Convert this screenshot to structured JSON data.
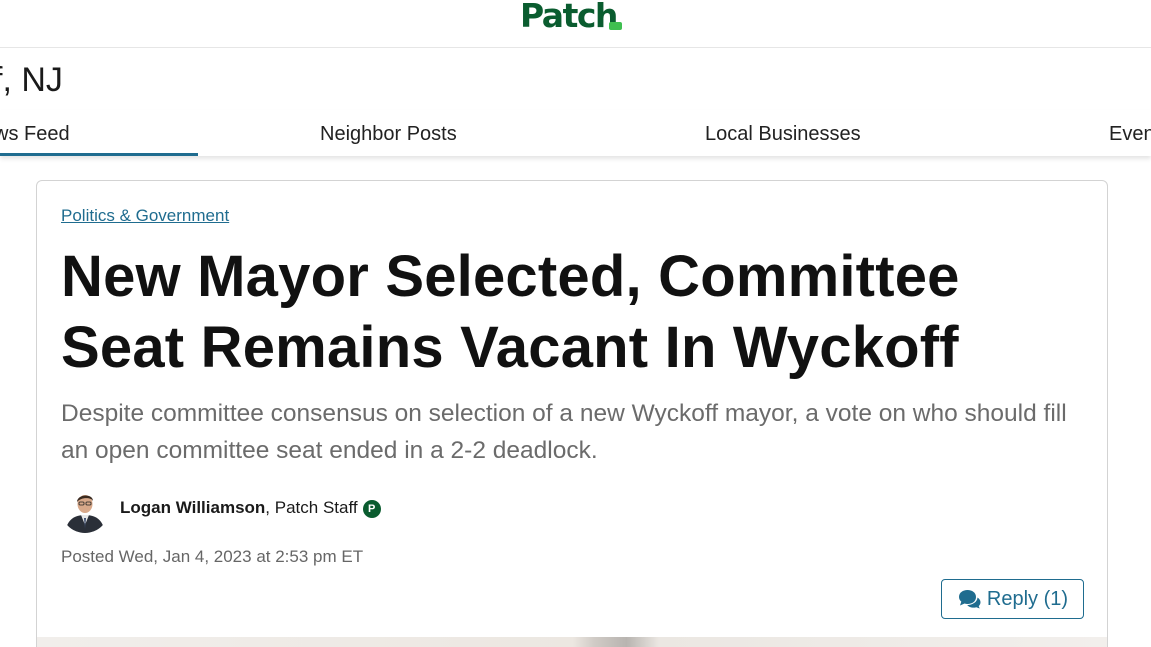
{
  "header": {
    "logo_text": "Patch",
    "town_title": "f, NJ"
  },
  "nav": {
    "items": [
      {
        "label": "ws Feed",
        "active": true
      },
      {
        "label": "Neighbor Posts",
        "active": false
      },
      {
        "label": "Local Businesses",
        "active": false
      },
      {
        "label": "Even",
        "active": false
      }
    ]
  },
  "article": {
    "category": "Politics & Government",
    "headline": "New Mayor Selected, Committee Seat Remains Vacant In Wyckoff",
    "dek": "Despite committee consensus on selection of a new Wyckoff mayor, a vote on who should fill an open committee seat ended in a 2-2 deadlock.",
    "author": {
      "name": "Logan Williamson",
      "separator": ",",
      "role": "Patch Staff",
      "badge": "P"
    },
    "posted": "Posted Wed, Jan 4, 2023 at 2:53 pm ET",
    "reply_label": "Reply (1)"
  },
  "colors": {
    "brand_green": "#0a5c2f",
    "accent_blue": "#1f6c8f",
    "muted_text": "#6b6b6b"
  }
}
